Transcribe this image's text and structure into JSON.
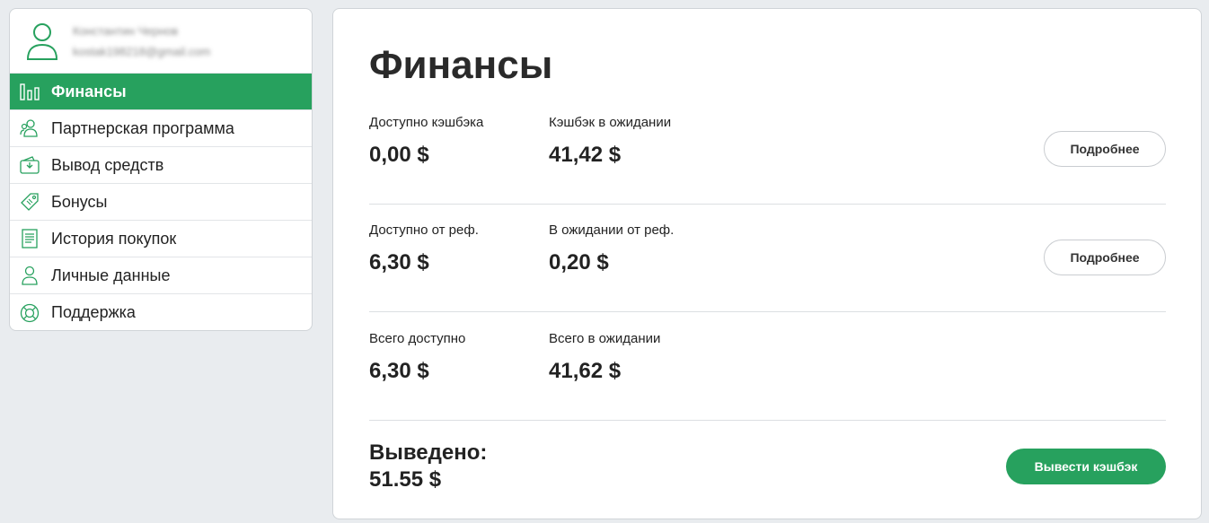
{
  "profile": {
    "name": "Константин Чернов",
    "email": "kostak198218@gmail.com"
  },
  "sidebar": {
    "items": [
      {
        "label": "Финансы",
        "icon": "bar-chart-icon",
        "active": true
      },
      {
        "label": "Партнерская программа",
        "icon": "users-icon",
        "active": false
      },
      {
        "label": "Вывод средств",
        "icon": "wallet-icon",
        "active": false
      },
      {
        "label": "Бонусы",
        "icon": "tag-icon",
        "active": false
      },
      {
        "label": "История покупок",
        "icon": "receipt-icon",
        "active": false
      },
      {
        "label": "Личные данные",
        "icon": "user-icon",
        "active": false
      },
      {
        "label": "Поддержка",
        "icon": "lifebuoy-icon",
        "active": false
      }
    ]
  },
  "main": {
    "title": "Финансы",
    "rows": [
      {
        "left_label": "Доступно кэшбэка",
        "left_value": "0,00 $",
        "right_label": "Кэшбэк в ожидании",
        "right_value": "41,42 $",
        "button": "Подробнее"
      },
      {
        "left_label": "Доступно от реф.",
        "left_value": "6,30 $",
        "right_label": "В ожидании от реф.",
        "right_value": "0,20 $",
        "button": "Подробнее"
      },
      {
        "left_label": "Всего доступно",
        "left_value": "6,30 $",
        "right_label": "Всего в ожидании",
        "right_value": "41,62 $"
      }
    ],
    "withdrawn_label": "Выведено:",
    "withdrawn_value": "51.55 $",
    "withdraw_button": "Вывести кэшбэк"
  },
  "colors": {
    "accent": "#27a15e",
    "background": "#e9ecef"
  }
}
